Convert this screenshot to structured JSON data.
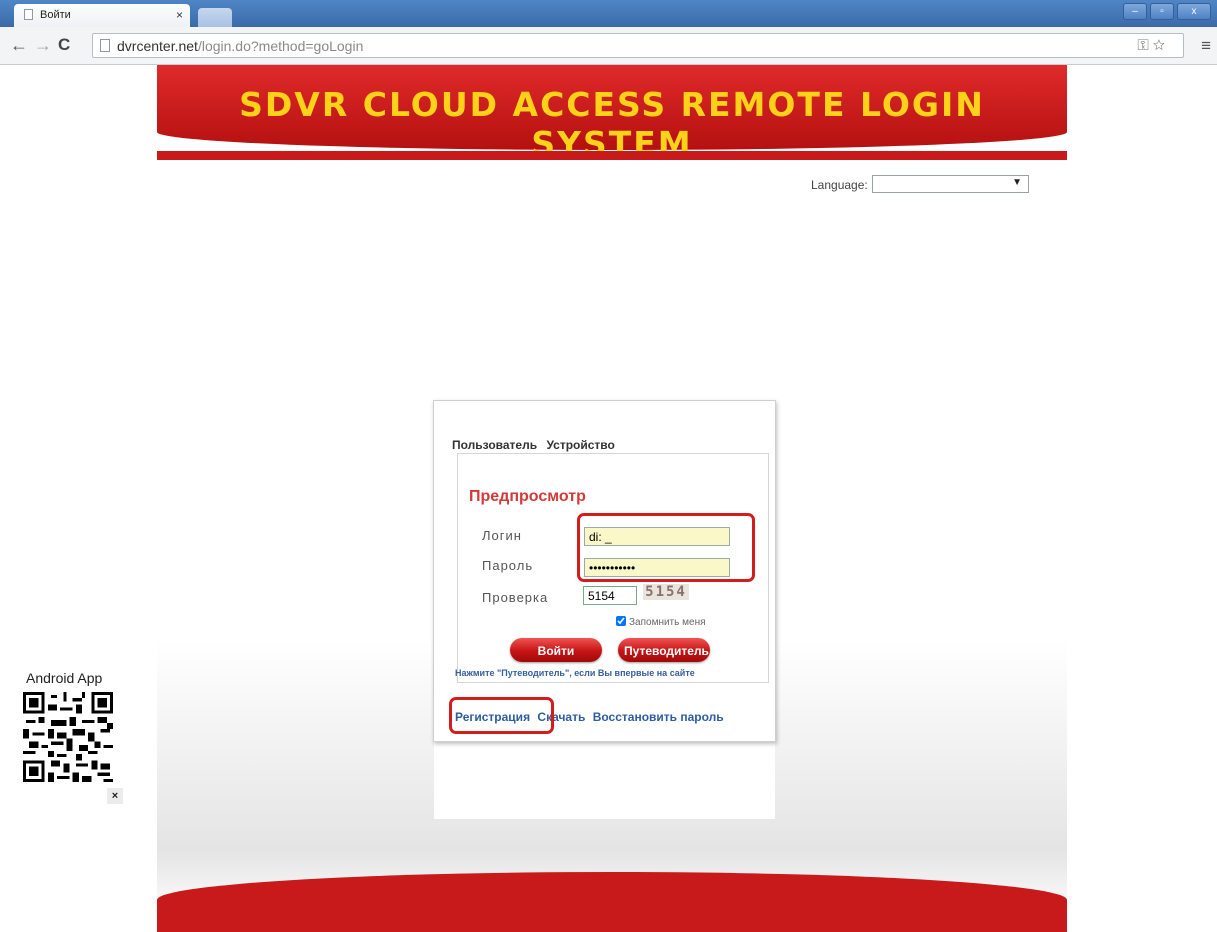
{
  "browser": {
    "tab_title": "Войти",
    "tab_close": "×",
    "url_host": "dvrcenter.net",
    "url_path": "/login.do?method=goLogin",
    "window_controls": [
      "–",
      "▫",
      "x"
    ]
  },
  "page": {
    "banner_title": "SDVR CLOUD ACCESS REMOTE LOGIN SYSTEM",
    "language_label": "Language:",
    "language_value": ""
  },
  "login": {
    "tabs": [
      "Пользователь",
      "Устройство"
    ],
    "title": "Предпросмотр",
    "login_label": "Логин",
    "login_value": "di: _",
    "password_label": "Пароль",
    "password_value": "•••••••••••",
    "check_label": "Проверка",
    "captcha_input": "5154",
    "captcha_image_text": "5154",
    "remember_label": "Запомнить меня",
    "login_button": "Войти",
    "guide_button": "Путеводитель",
    "hint": "Нажмите \"Путеводитель\", если Вы впервые на сайте",
    "links": {
      "register": "Регистрация",
      "download": "Скачать",
      "restore": "Восстановить пароль"
    }
  },
  "android": {
    "label": "Android App",
    "close": "×"
  },
  "colors": {
    "brand_red": "#c81a1a",
    "banner_text": "#ffd21a",
    "link_blue": "#2d5da0",
    "highlight": "#d51c1c"
  }
}
